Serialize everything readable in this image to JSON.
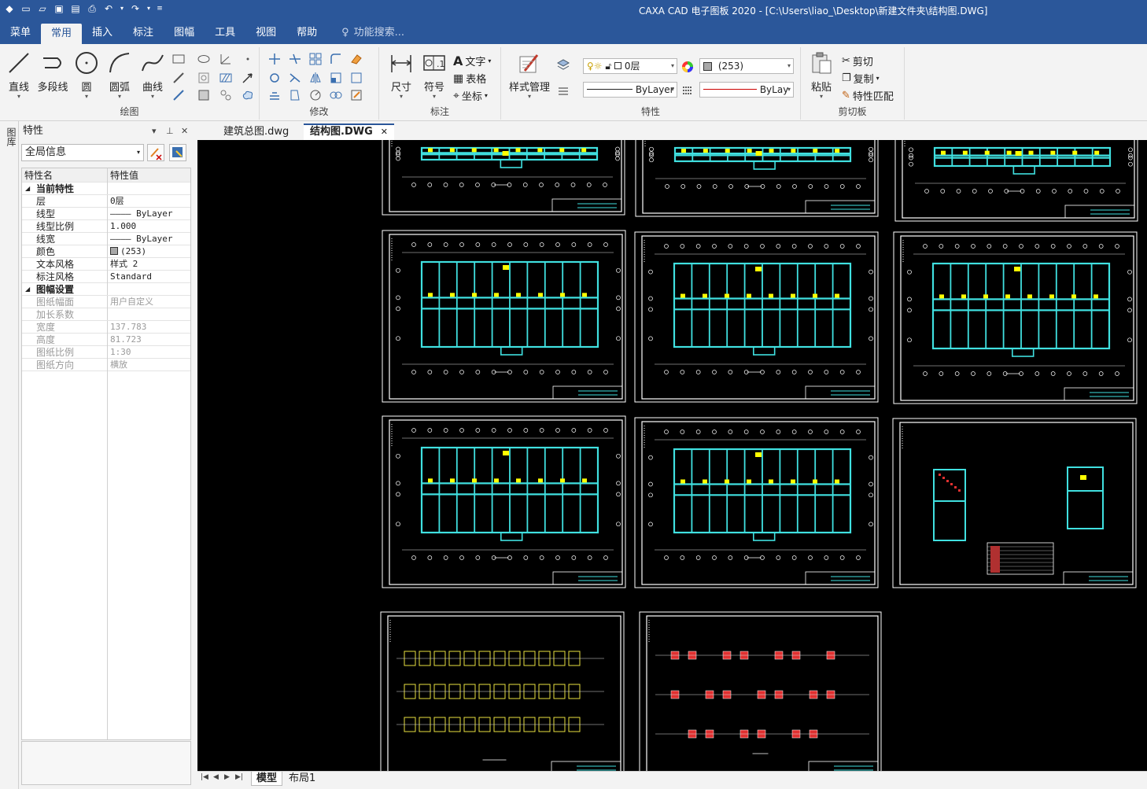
{
  "window": {
    "title": "CAXA CAD 电子图板 2020 - [C:\\Users\\liao_\\Desktop\\新建文件夹\\结构图.DWG]"
  },
  "menu": {
    "items": [
      "菜单",
      "常用",
      "插入",
      "标注",
      "图幅",
      "工具",
      "视图",
      "帮助"
    ],
    "search_placeholder": "功能搜索..."
  },
  "ribbon": {
    "draw": {
      "label": "绘图",
      "line": "直线",
      "polyline": "多段线",
      "circle": "圆",
      "arc": "圆弧",
      "curve": "曲线"
    },
    "modify": {
      "label": "修改"
    },
    "annotate": {
      "label": "标注",
      "dimension": "尺寸",
      "symbol": "符号",
      "text": "文字",
      "table": "表格",
      "coordinate": "坐标"
    },
    "style": {
      "label": "样式管理"
    },
    "properties": {
      "label": "特性",
      "layer": "0层",
      "color": "(253)",
      "linetype": "ByLayer",
      "linewidth": "ByLay"
    },
    "clipboard": {
      "label": "剪切板",
      "paste": "粘贴",
      "cut": "剪切",
      "copy": "复制",
      "match": "特性匹配"
    }
  },
  "side_strip": {
    "label": "图库"
  },
  "properties_panel": {
    "title": "特性",
    "selector": "全局信息",
    "col_name": "特性名",
    "col_value": "特性值",
    "rows": [
      {
        "name": "当前特性",
        "value": "",
        "type": "section"
      },
      {
        "name": "层",
        "value": "0层",
        "type": "normal"
      },
      {
        "name": "线型",
        "value": "———— ByLayer",
        "type": "normal"
      },
      {
        "name": "线型比例",
        "value": "1.000",
        "type": "normal"
      },
      {
        "name": "线宽",
        "value": "———— ByLayer",
        "type": "normal"
      },
      {
        "name": "颜色",
        "value": "(253)",
        "type": "color"
      },
      {
        "name": "文本风格",
        "value": "样式 2",
        "type": "normal"
      },
      {
        "name": "标注风格",
        "value": "Standard",
        "type": "normal"
      },
      {
        "name": "图幅设置",
        "value": "",
        "type": "section"
      },
      {
        "name": "图纸幅面",
        "value": "用户自定义",
        "type": "disabled"
      },
      {
        "name": "加长系数",
        "value": "",
        "type": "disabled"
      },
      {
        "name": "宽度",
        "value": "137.783",
        "type": "disabled"
      },
      {
        "name": "高度",
        "value": "81.723",
        "type": "disabled"
      },
      {
        "name": "图纸比例",
        "value": "1:30",
        "type": "disabled"
      },
      {
        "name": "图纸方向",
        "value": "横放",
        "type": "disabled"
      }
    ]
  },
  "doc_tabs": [
    {
      "label": "建筑总图.dwg",
      "active": false
    },
    {
      "label": "结构图.DWG",
      "active": true
    }
  ],
  "layout_tabs": [
    {
      "label": "模型",
      "active": true
    },
    {
      "label": "布局1",
      "active": false
    }
  ],
  "colors": {
    "accent": "#2b579a",
    "canvas": "#000000",
    "cyan": "#40e0e0",
    "yellow": "#ffff00",
    "red": "#e03030"
  }
}
